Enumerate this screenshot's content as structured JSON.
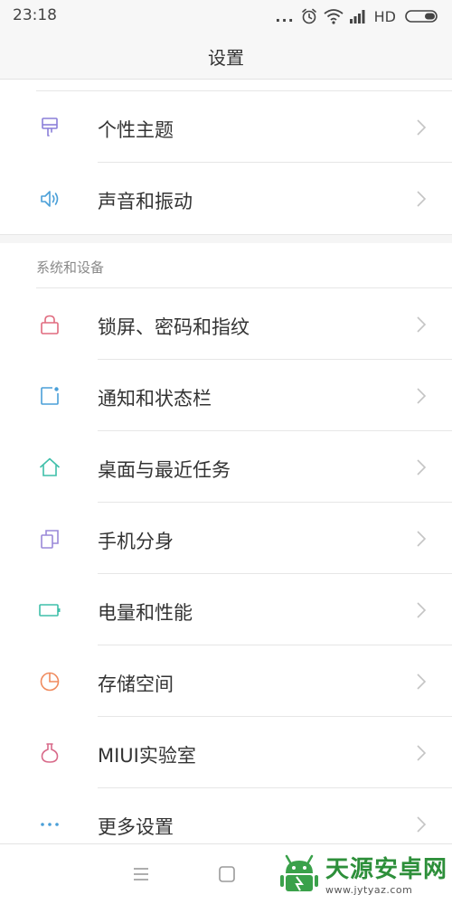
{
  "status_bar": {
    "time": "23:18",
    "more": "...",
    "network": "HD"
  },
  "header": {
    "title": "设置"
  },
  "groups": [
    {
      "items": [
        {
          "label": "个性主题",
          "icon": "paintbrush-icon",
          "color": "#8a7fd9"
        },
        {
          "label": "声音和振动",
          "icon": "speaker-icon",
          "color": "#4a9fd8"
        }
      ]
    },
    {
      "title": "系统和设备",
      "items": [
        {
          "label": "锁屏、密码和指纹",
          "icon": "lock-icon",
          "color": "#e06a7e"
        },
        {
          "label": "通知和状态栏",
          "icon": "notification-icon",
          "color": "#4a9fd8"
        },
        {
          "label": "桌面与最近任务",
          "icon": "home-icon",
          "color": "#3fbfaa"
        },
        {
          "label": "手机分身",
          "icon": "dual-phone-icon",
          "color": "#9a88d8"
        },
        {
          "label": "电量和性能",
          "icon": "battery-icon",
          "color": "#3fbfaa"
        },
        {
          "label": "存储空间",
          "icon": "pie-chart-icon",
          "color": "#f08a5d"
        },
        {
          "label": "MIUI实验室",
          "icon": "flask-icon",
          "color": "#d86a8a"
        },
        {
          "label": "更多设置",
          "icon": "more-dots-icon",
          "color": "#4a9fd8"
        }
      ]
    }
  ],
  "watermark": {
    "name": "天源安卓网",
    "url": "www.jytyaz.com"
  },
  "colors": {
    "chevron": "#c4c4c4",
    "divider": "#e6e6e6",
    "watermark_green": "#2d8f3a"
  }
}
